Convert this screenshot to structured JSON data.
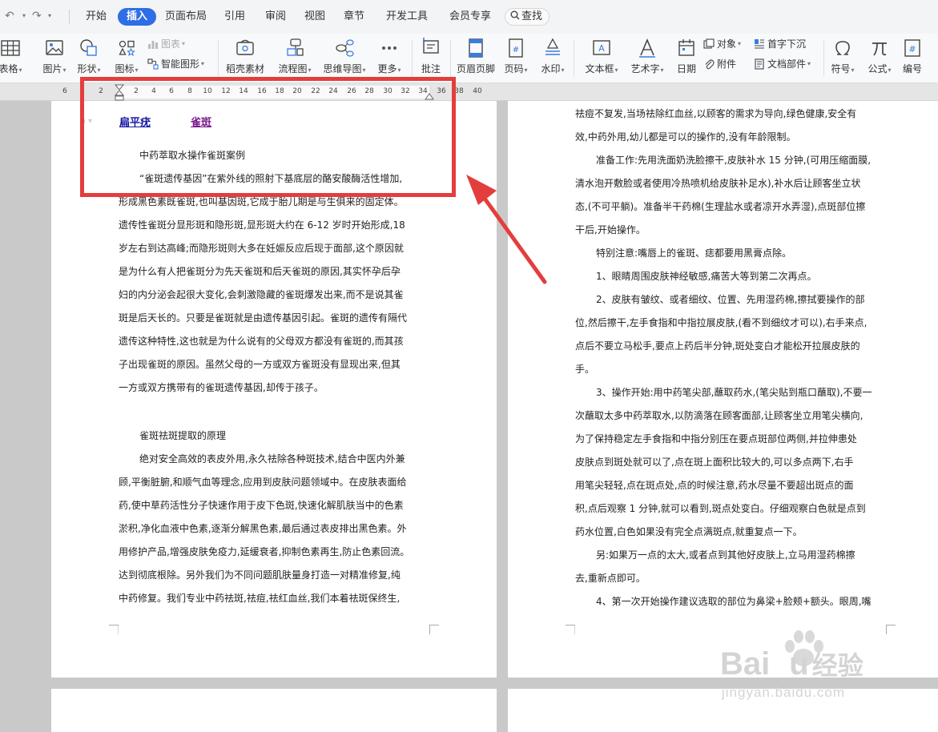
{
  "menu": {
    "tabs": [
      {
        "label": "开始"
      },
      {
        "label": "插入"
      },
      {
        "label": "页面布局"
      },
      {
        "label": "引用"
      },
      {
        "label": "审阅"
      },
      {
        "label": "视图"
      },
      {
        "label": "章节"
      },
      {
        "label": "开发工具"
      },
      {
        "label": "会员专享"
      }
    ],
    "search_label": "查找",
    "active_tab": "插入"
  },
  "ribbon": {
    "table": "表格",
    "picture": "图片",
    "shape": "形状",
    "icons": "图标",
    "chart": "图表",
    "smart_graphic": "智能图形",
    "daoke": "稻壳素材",
    "flowchart": "流程图",
    "mindmap": "思维导图",
    "more": "更多",
    "comment": "批注",
    "header_footer": "页眉页脚",
    "page_number": "页码",
    "watermark": "水印",
    "textbox": "文本框",
    "wordart": "艺术字",
    "date": "日期",
    "object": "对象",
    "attachment": "附件",
    "dropcap": "首字下沉",
    "doc_parts": "文档部件",
    "symbol": "符号",
    "formula": "公式",
    "numbering": "编号"
  },
  "ruler": {
    "ticks": [
      "6",
      "2",
      "2",
      "4",
      "6",
      "8",
      "10",
      "12",
      "14",
      "16",
      "18",
      "20",
      "22",
      "24",
      "26",
      "28",
      "30",
      "32",
      "34",
      "36",
      "38",
      "40"
    ]
  },
  "left_page": {
    "header_links": [
      "扁平疣",
      "雀斑"
    ],
    "heading1": "中药萃取水操作雀斑案例",
    "para1": [
      "“雀斑遗传基因”在紫外线的照射下基底层的酪安酸酶活性增加,",
      "形成黑色素既雀斑,也叫基因斑,它成于胎儿期是与生俱来的固定体。",
      "遗传性雀斑分显形斑和隐形斑,显形斑大约在 6-12 岁时开始形成,18",
      "岁左右到达高峰;而隐形斑则大多在妊娠反应后现于面部,这个原因就",
      "是为什么有人把雀斑分为先天雀斑和后天雀斑的原因,其实怀孕后孕",
      "妇的内分泌会起很大变化,会刺激隐藏的雀斑爆发出来,而不是说其雀",
      "斑是后天长的。只要是雀斑就是由遗传基因引起。雀斑的遗传有隔代",
      "遗传这种特性,这也就是为什么说有的父母双方都没有雀斑的,而其孩",
      "子出现雀斑的原因。虽然父母的一方或双方雀斑没有显现出来,但其",
      "一方或双方携带有的雀斑遗传基因,却传于孩子。"
    ],
    "heading2": "雀斑祛斑提取的原理",
    "para2": [
      "绝对安全高效的表皮外用,永久祛除各种斑技术,结合中医内外兼",
      "顾,平衡脏腑,和顺气血等理念,应用到皮肤问题领域中。在皮肤表面给",
      "药,使中草药活性分子快速作用于皮下色斑,快速化解肌肤当中的色素",
      "淤积,净化血液中色素,逐渐分解黑色素,最后通过表皮排出黑色素。外",
      "用修护产品,增强皮肤免疫力,延缓衰者,抑制色素再生,防止色素回流。",
      "达到彻底根除。另外我们为不同问题肌肤量身打造一对精准修复,纯",
      "中药修复。我们专业中药祛斑,祛痘,祛红血丝,我们本着祛斑保终生,"
    ]
  },
  "right_page": {
    "lines": [
      "祛痘不复发,当场祛除红血丝,以顾客的需求为导向,绿色健康,安全有",
      "效,中药外用,幼儿都是可以的操作的,没有年龄限制。",
      "准备工作:先用洗面奶洗脸擦干,皮肤补水 15 分钟,(可用压缩面膜,",
      "清水泡开敷脸或者使用冷热喷机给皮肤补足水),补水后让顾客坐立状",
      "态,(不可平躺)。准备半干药棉(生理盐水或者凉开水弄湿),点斑部位擦",
      "干后,开始操作。",
      "特别注意:嘴唇上的雀斑、痣都要用黑膏点除。",
      "1、眼睛周围皮肤神经敏感,痛苦大等到第二次再点。",
      "2、皮肤有皱纹、或者细纹、位置、先用湿药棉,擦拭要操作的部",
      "位,然后擦干,左手食指和中指拉展皮肤,(看不到细纹才可以),右手来点,",
      "点后不要立马松手,要点上药后半分钟,斑处变白才能松开拉展皮肤的",
      "手。",
      "3、操作开始:用中药笔尖部,蘸取药水,(笔尖贴到瓶口蘸取),不要一",
      "次蘸取太多中药萃取水,以防滴落在顾客面部,让顾客坐立用笔尖横向,",
      "为了保持稳定左手食指和中指分别压在要点斑部位两侧,并拉伸患处",
      "皮肤点到斑处就可以了,点在斑上面积比较大的,可以多点两下,右手",
      "用笔尖轻轻,点在斑点处,点的时候注意,药水尽量不要超出斑点的面",
      "积,点后观察 1 分钟,就可以看到,斑点处变白。仔细观察白色就是点到",
      "药水位置,白色如果没有完全点满斑点,就重复点一下。",
      "另:如果万一点的太大,或者点到其他好皮肤上,立马用湿药棉擦",
      "去,重新点即可。",
      "4、第一次开始操作建议选取的部位为鼻梁+脸颊+额头。眼周,嘴"
    ]
  },
  "watermark": {
    "brand": "Bai",
    "brand_end": "u",
    "cn": "经验",
    "url": "jingyan.baidu.com"
  },
  "colors": {
    "accent": "#2e6ee6",
    "highlight": "#e43d3d",
    "link_blue": "#1a1aa6",
    "link_purple": "#7a1a8c"
  }
}
